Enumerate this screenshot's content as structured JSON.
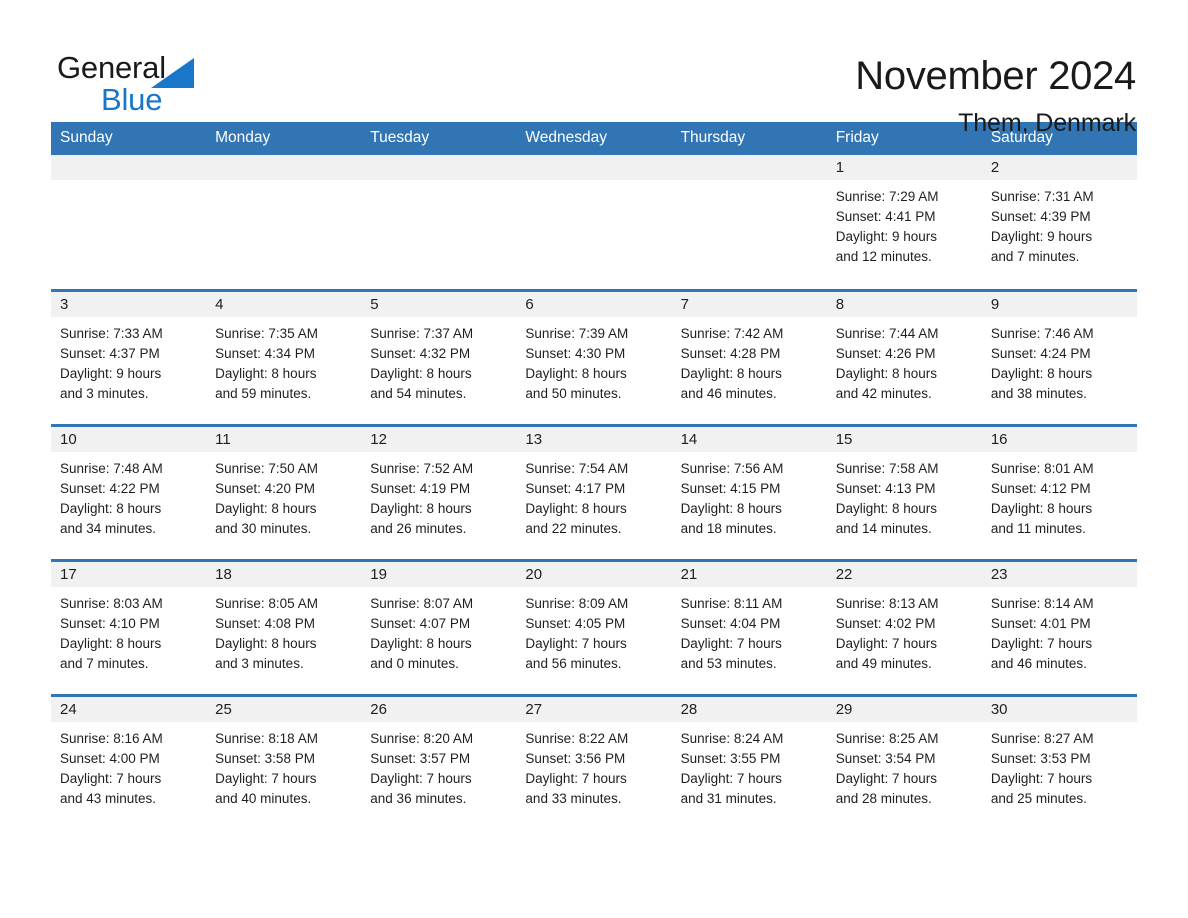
{
  "brand": {
    "name_part1": "General",
    "name_part2": "Blue",
    "accent_color": "#1a76c9"
  },
  "header": {
    "title": "November 2024",
    "location": "Them, Denmark"
  },
  "theme": {
    "header_blue": "#3275b4",
    "daynum_band": "#f1f1f1",
    "text": "#1f1f1f"
  },
  "weekday_headers": [
    "Sunday",
    "Monday",
    "Tuesday",
    "Wednesday",
    "Thursday",
    "Friday",
    "Saturday"
  ],
  "labels": {
    "sunrise_prefix": "Sunrise:",
    "sunset_prefix": "Sunset:",
    "daylight_prefix": "Daylight:"
  },
  "weeks": [
    [
      {
        "day": "",
        "empty": true
      },
      {
        "day": "",
        "empty": true
      },
      {
        "day": "",
        "empty": true
      },
      {
        "day": "",
        "empty": true
      },
      {
        "day": "",
        "empty": true
      },
      {
        "day": "1",
        "sunrise": "Sunrise: 7:29 AM",
        "sunset": "Sunset: 4:41 PM",
        "daylight_l1": "Daylight: 9 hours",
        "daylight_l2": "and 12 minutes."
      },
      {
        "day": "2",
        "sunrise": "Sunrise: 7:31 AM",
        "sunset": "Sunset: 4:39 PM",
        "daylight_l1": "Daylight: 9 hours",
        "daylight_l2": "and 7 minutes."
      }
    ],
    [
      {
        "day": "3",
        "sunrise": "Sunrise: 7:33 AM",
        "sunset": "Sunset: 4:37 PM",
        "daylight_l1": "Daylight: 9 hours",
        "daylight_l2": "and 3 minutes."
      },
      {
        "day": "4",
        "sunrise": "Sunrise: 7:35 AM",
        "sunset": "Sunset: 4:34 PM",
        "daylight_l1": "Daylight: 8 hours",
        "daylight_l2": "and 59 minutes."
      },
      {
        "day": "5",
        "sunrise": "Sunrise: 7:37 AM",
        "sunset": "Sunset: 4:32 PM",
        "daylight_l1": "Daylight: 8 hours",
        "daylight_l2": "and 54 minutes."
      },
      {
        "day": "6",
        "sunrise": "Sunrise: 7:39 AM",
        "sunset": "Sunset: 4:30 PM",
        "daylight_l1": "Daylight: 8 hours",
        "daylight_l2": "and 50 minutes."
      },
      {
        "day": "7",
        "sunrise": "Sunrise: 7:42 AM",
        "sunset": "Sunset: 4:28 PM",
        "daylight_l1": "Daylight: 8 hours",
        "daylight_l2": "and 46 minutes."
      },
      {
        "day": "8",
        "sunrise": "Sunrise: 7:44 AM",
        "sunset": "Sunset: 4:26 PM",
        "daylight_l1": "Daylight: 8 hours",
        "daylight_l2": "and 42 minutes."
      },
      {
        "day": "9",
        "sunrise": "Sunrise: 7:46 AM",
        "sunset": "Sunset: 4:24 PM",
        "daylight_l1": "Daylight: 8 hours",
        "daylight_l2": "and 38 minutes."
      }
    ],
    [
      {
        "day": "10",
        "sunrise": "Sunrise: 7:48 AM",
        "sunset": "Sunset: 4:22 PM",
        "daylight_l1": "Daylight: 8 hours",
        "daylight_l2": "and 34 minutes."
      },
      {
        "day": "11",
        "sunrise": "Sunrise: 7:50 AM",
        "sunset": "Sunset: 4:20 PM",
        "daylight_l1": "Daylight: 8 hours",
        "daylight_l2": "and 30 minutes."
      },
      {
        "day": "12",
        "sunrise": "Sunrise: 7:52 AM",
        "sunset": "Sunset: 4:19 PM",
        "daylight_l1": "Daylight: 8 hours",
        "daylight_l2": "and 26 minutes."
      },
      {
        "day": "13",
        "sunrise": "Sunrise: 7:54 AM",
        "sunset": "Sunset: 4:17 PM",
        "daylight_l1": "Daylight: 8 hours",
        "daylight_l2": "and 22 minutes."
      },
      {
        "day": "14",
        "sunrise": "Sunrise: 7:56 AM",
        "sunset": "Sunset: 4:15 PM",
        "daylight_l1": "Daylight: 8 hours",
        "daylight_l2": "and 18 minutes."
      },
      {
        "day": "15",
        "sunrise": "Sunrise: 7:58 AM",
        "sunset": "Sunset: 4:13 PM",
        "daylight_l1": "Daylight: 8 hours",
        "daylight_l2": "and 14 minutes."
      },
      {
        "day": "16",
        "sunrise": "Sunrise: 8:01 AM",
        "sunset": "Sunset: 4:12 PM",
        "daylight_l1": "Daylight: 8 hours",
        "daylight_l2": "and 11 minutes."
      }
    ],
    [
      {
        "day": "17",
        "sunrise": "Sunrise: 8:03 AM",
        "sunset": "Sunset: 4:10 PM",
        "daylight_l1": "Daylight: 8 hours",
        "daylight_l2": "and 7 minutes."
      },
      {
        "day": "18",
        "sunrise": "Sunrise: 8:05 AM",
        "sunset": "Sunset: 4:08 PM",
        "daylight_l1": "Daylight: 8 hours",
        "daylight_l2": "and 3 minutes."
      },
      {
        "day": "19",
        "sunrise": "Sunrise: 8:07 AM",
        "sunset": "Sunset: 4:07 PM",
        "daylight_l1": "Daylight: 8 hours",
        "daylight_l2": "and 0 minutes."
      },
      {
        "day": "20",
        "sunrise": "Sunrise: 8:09 AM",
        "sunset": "Sunset: 4:05 PM",
        "daylight_l1": "Daylight: 7 hours",
        "daylight_l2": "and 56 minutes."
      },
      {
        "day": "21",
        "sunrise": "Sunrise: 8:11 AM",
        "sunset": "Sunset: 4:04 PM",
        "daylight_l1": "Daylight: 7 hours",
        "daylight_l2": "and 53 minutes."
      },
      {
        "day": "22",
        "sunrise": "Sunrise: 8:13 AM",
        "sunset": "Sunset: 4:02 PM",
        "daylight_l1": "Daylight: 7 hours",
        "daylight_l2": "and 49 minutes."
      },
      {
        "day": "23",
        "sunrise": "Sunrise: 8:14 AM",
        "sunset": "Sunset: 4:01 PM",
        "daylight_l1": "Daylight: 7 hours",
        "daylight_l2": "and 46 minutes."
      }
    ],
    [
      {
        "day": "24",
        "sunrise": "Sunrise: 8:16 AM",
        "sunset": "Sunset: 4:00 PM",
        "daylight_l1": "Daylight: 7 hours",
        "daylight_l2": "and 43 minutes."
      },
      {
        "day": "25",
        "sunrise": "Sunrise: 8:18 AM",
        "sunset": "Sunset: 3:58 PM",
        "daylight_l1": "Daylight: 7 hours",
        "daylight_l2": "and 40 minutes."
      },
      {
        "day": "26",
        "sunrise": "Sunrise: 8:20 AM",
        "sunset": "Sunset: 3:57 PM",
        "daylight_l1": "Daylight: 7 hours",
        "daylight_l2": "and 36 minutes."
      },
      {
        "day": "27",
        "sunrise": "Sunrise: 8:22 AM",
        "sunset": "Sunset: 3:56 PM",
        "daylight_l1": "Daylight: 7 hours",
        "daylight_l2": "and 33 minutes."
      },
      {
        "day": "28",
        "sunrise": "Sunrise: 8:24 AM",
        "sunset": "Sunset: 3:55 PM",
        "daylight_l1": "Daylight: 7 hours",
        "daylight_l2": "and 31 minutes."
      },
      {
        "day": "29",
        "sunrise": "Sunrise: 8:25 AM",
        "sunset": "Sunset: 3:54 PM",
        "daylight_l1": "Daylight: 7 hours",
        "daylight_l2": "and 28 minutes."
      },
      {
        "day": "30",
        "sunrise": "Sunrise: 8:27 AM",
        "sunset": "Sunset: 3:53 PM",
        "daylight_l1": "Daylight: 7 hours",
        "daylight_l2": "and 25 minutes."
      }
    ]
  ]
}
